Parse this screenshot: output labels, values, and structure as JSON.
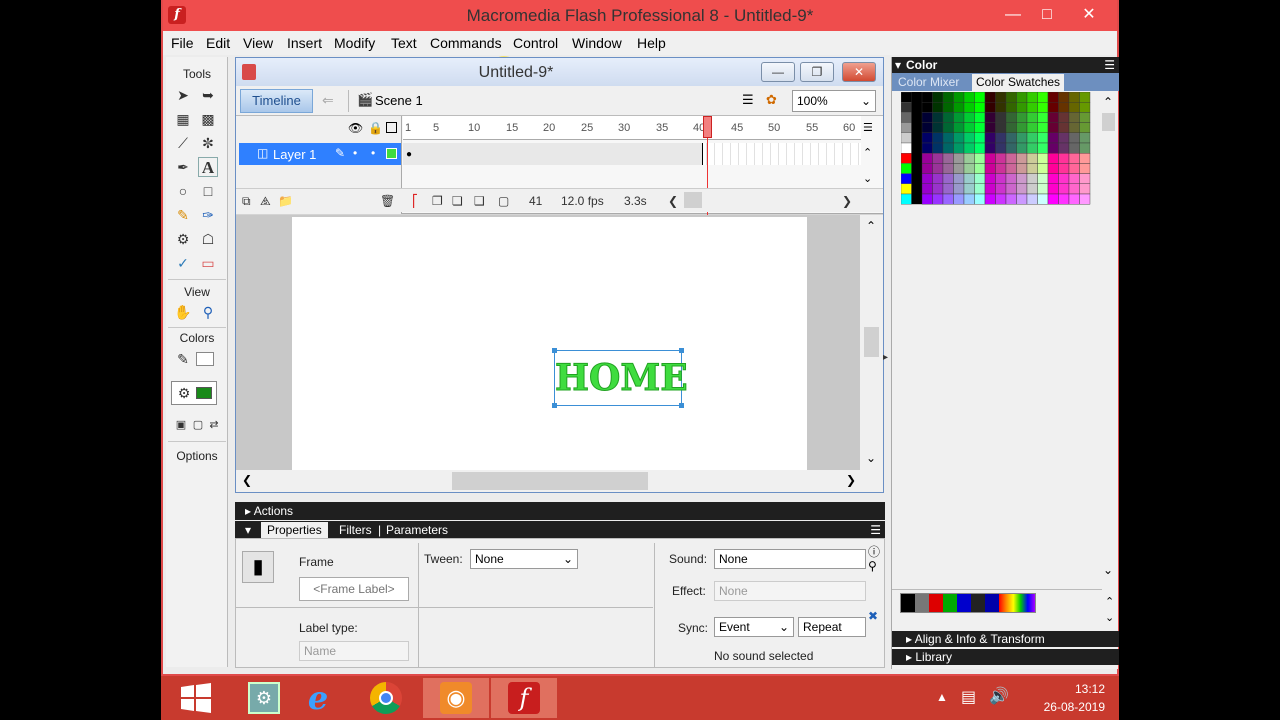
{
  "app": {
    "title": "Macromedia Flash Professional 8 - Untitled-9*"
  },
  "menu": [
    "File",
    "Edit",
    "View",
    "Insert",
    "Modify",
    "Text",
    "Commands",
    "Control",
    "Window",
    "Help"
  ],
  "tools": {
    "tools_label": "Tools",
    "view_label": "View",
    "colors_label": "Colors",
    "options_label": "Options",
    "fill_color": "#1a8a1a"
  },
  "document": {
    "title": "Untitled-9*",
    "timeline_label": "Timeline",
    "scene_label": "Scene 1",
    "zoom": "100%",
    "layer_name": "Layer 1",
    "ruler_ticks": [
      "1",
      "5",
      "10",
      "15",
      "20",
      "25",
      "30",
      "35",
      "40",
      "45",
      "50",
      "55",
      "60"
    ],
    "current_frame": "41",
    "frame_rate": "12.0 fps",
    "elapsed": "3.3s",
    "stage_text": "HOME",
    "stage_text_color": "#3fdc3f"
  },
  "panels": {
    "actions": "Actions",
    "tabs": [
      "Properties",
      "Filters",
      "Parameters"
    ]
  },
  "properties": {
    "frame_label": "Frame",
    "frame_label_placeholder": "<Frame Label>",
    "label_type_label": "Label type:",
    "label_type_value": "Name",
    "tween_label": "Tween:",
    "tween_value": "None",
    "sound_label": "Sound:",
    "sound_value": "None",
    "effect_label": "Effect:",
    "effect_value": "None",
    "sync_label": "Sync:",
    "sync_value": "Event",
    "repeat_value": "Repeat",
    "no_sound_text": "No sound selected"
  },
  "color_panel": {
    "title": "Color",
    "tabs": [
      "Color Mixer",
      "Color Swatches"
    ],
    "align_label": "Align & Info & Transform",
    "library_label": "Library"
  },
  "taskbar": {
    "time": "13:12",
    "date": "26-08-2019"
  }
}
